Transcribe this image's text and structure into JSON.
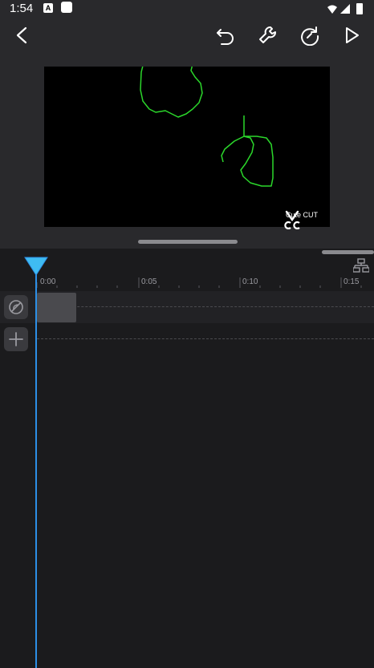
{
  "status_bar": {
    "time": "1:54",
    "notification_icon_a": "A"
  },
  "toolbar": {
    "back_icon": "chevron-left-icon",
    "undo_icon": "undo-icon",
    "tools_icon": "wrench-icon",
    "redo_icon": "redo-icon",
    "play_icon": "play-icon"
  },
  "preview": {
    "watermark_text": "Cute CUT",
    "stroke_color": "#2bd72b",
    "background": "#000000"
  },
  "timeline": {
    "tick_labels": [
      "0:00",
      "0:05",
      "0:10",
      "0:15"
    ],
    "playhead_color": "#2d8fe6",
    "tracks": [
      {
        "name": "video-track",
        "icon": "clip-icon"
      },
      {
        "name": "add-track",
        "icon": "plus-icon"
      }
    ]
  }
}
